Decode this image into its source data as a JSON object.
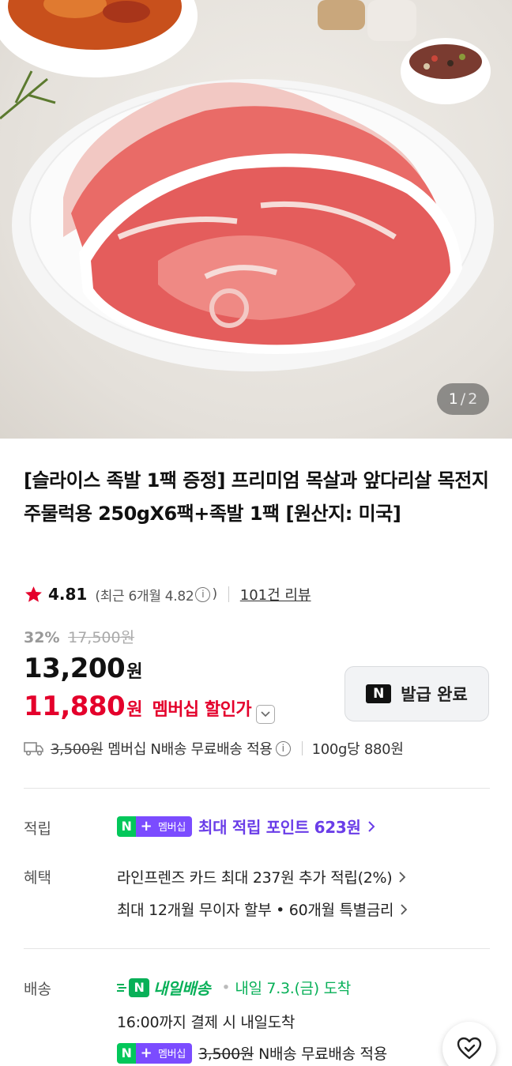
{
  "gallery": {
    "current": "1",
    "separator": "/",
    "total": "2"
  },
  "product": {
    "title": "[슬라이스 족발 1팩 증정] 프리미엄 목살과 앞다리살 목전지 주물럭용 250gX6팩+족발 1팩 [원산지: 미국]",
    "rating": "4.81",
    "recent_rating": "(최근 6개월 4.82",
    "recent_rating_close": ")",
    "info_glyph": "i",
    "review_count": "101건 리뷰"
  },
  "price": {
    "discount_rate": "32%",
    "original": "17,500원",
    "sale": "13,200",
    "won": "원",
    "member_price": "11,880",
    "member_label": "멤버십 할인가",
    "coupon_logo": "N",
    "coupon_button": "발급 완료"
  },
  "shipping_summary": {
    "original_fee": "3,500원",
    "text": "멤버십 N배송 무료배송 적용",
    "unit_price": "100g당 880원"
  },
  "points_row": {
    "label": "적립",
    "badge_n": "N",
    "badge_plus": "+",
    "badge_member": "멤버십",
    "text": "최대 적립 포인트 623원"
  },
  "benefits_row": {
    "label": "혜택",
    "line1": "라인프렌즈 카드 최대 237원 추가 적립(2%)",
    "line2": "최대 12개월 무이자 할부 • 60개월 특별금리"
  },
  "delivery_row": {
    "label": "배송",
    "badge_n": "N",
    "badge_text": "내일배송",
    "dot": "•",
    "arrival": "내일 7.3.(금) 도착",
    "cutoff": "16:00까지 결제 시 내일도착",
    "badge_plus": "+",
    "badge_member": "멤버십",
    "fee_original": "3,500원",
    "fee_text": "N배송 무료배송 적용"
  },
  "colors": {
    "accent_red": "#e4002b",
    "naver_green": "#03c75a",
    "membership_purple": "#7b4cff"
  }
}
